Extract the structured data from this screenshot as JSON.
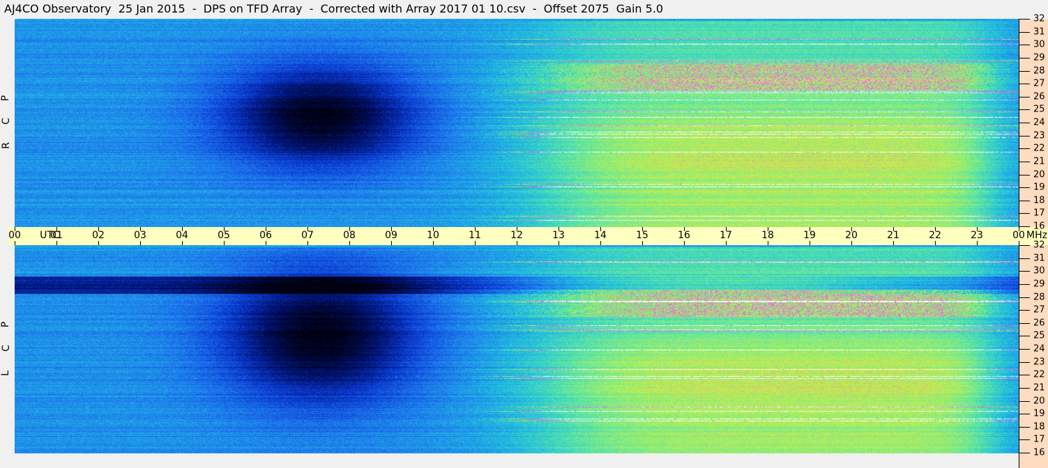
{
  "title": "AJ4CO Observatory  25 Jan 2015  -  DPS on TFD Array  -  Corrected with Array 2017 01 10.csv  -  Offset 2075  Gain 5.0",
  "chart_data": {
    "type": "heatmap",
    "title": "AJ4CO Observatory  25 Jan 2015  -  DPS on TFD Array  -  Corrected with Array 2017 01 10.csv  -  Offset 2075  Gain 5.0",
    "xlabel": "UTC",
    "ylabel": "MHz",
    "x_ticks": [
      "00",
      "01",
      "02",
      "03",
      "04",
      "05",
      "06",
      "07",
      "08",
      "09",
      "10",
      "11",
      "12",
      "13",
      "14",
      "15",
      "16",
      "17",
      "18",
      "19",
      "20",
      "21",
      "22",
      "23",
      "00"
    ],
    "xlim_hours": [
      0,
      24
    ],
    "y_ticks": [
      "32",
      "31",
      "30",
      "29",
      "28",
      "27",
      "26",
      "25",
      "24",
      "23",
      "22",
      "21",
      "20",
      "19",
      "18",
      "17",
      "16"
    ],
    "ylim_mhz": [
      16,
      32
    ],
    "panels": [
      {
        "name": "RCP",
        "letters": [
          "R",
          "C",
          "P"
        ]
      },
      {
        "name": "LCP",
        "letters": [
          "L",
          "C",
          "P"
        ]
      }
    ],
    "colorscale": [
      "#000010",
      "#00106a",
      "#0a3ad0",
      "#1e78ee",
      "#20c0e0",
      "#60e8a0",
      "#d0f040",
      "#ff40ff",
      "#ffffff"
    ]
  }
}
